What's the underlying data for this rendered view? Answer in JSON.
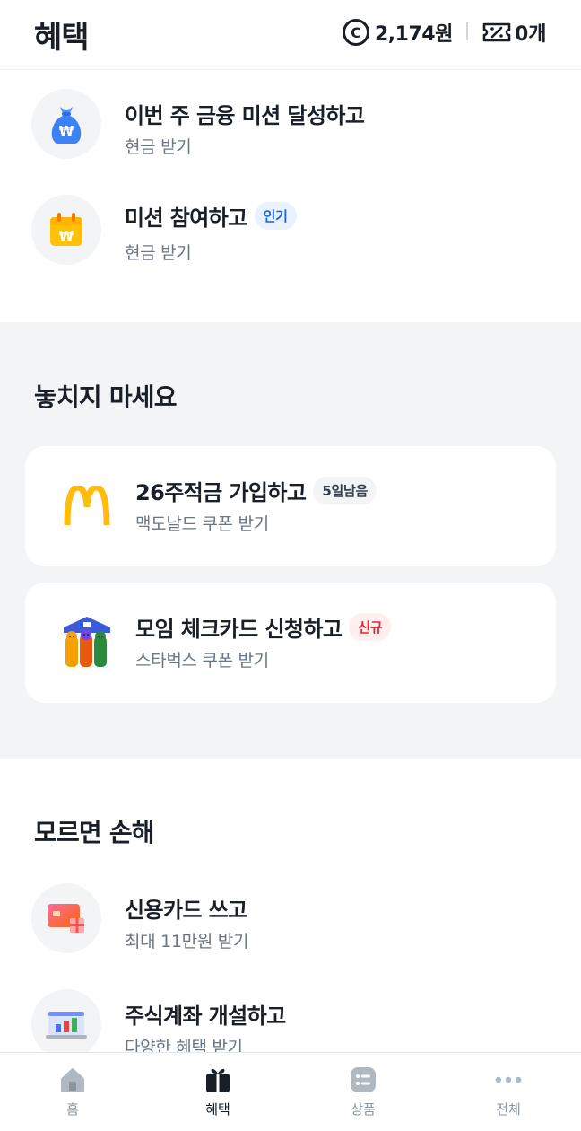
{
  "header": {
    "title": "혜택",
    "points": "2,174원",
    "coupons": "0개"
  },
  "missions": [
    {
      "title": "이번 주 금융 미션 달성하고",
      "subtitle": "현금 받기",
      "icon": "money-bag-icon"
    },
    {
      "title": "미션 참여하고",
      "badge": "인기",
      "subtitle": "현금 받기",
      "icon": "calendar-won-icon"
    }
  ],
  "dont_miss": {
    "title": "놓치지 마세요",
    "cards": [
      {
        "title": "26주적금 가입하고",
        "badge": "5일남음",
        "subtitle": "맥도날드 쿠폰 받기",
        "icon": "mcdonalds-logo"
      },
      {
        "title": "모임 체크카드 신청하고",
        "badge": "신규",
        "subtitle": "스타벅스 쿠폰 받기",
        "icon": "group-house-icon"
      }
    ]
  },
  "dont_lose": {
    "title": "모르면 손해",
    "items": [
      {
        "title": "신용카드 쓰고",
        "subtitle": "최대 11만원 받기",
        "icon": "credit-card-gift-icon"
      },
      {
        "title": "주식계좌 개설하고",
        "subtitle": "다양한 혜택 받기",
        "icon": "stock-chart-icon"
      }
    ]
  },
  "nav": [
    {
      "label": "홈",
      "icon": "home-icon",
      "active": false
    },
    {
      "label": "혜택",
      "icon": "gift-icon",
      "active": true
    },
    {
      "label": "상품",
      "icon": "list-icon",
      "active": false
    },
    {
      "label": "전체",
      "icon": "more-dots-icon",
      "active": false
    }
  ],
  "colors": {
    "accent_blue": "#1b64da",
    "badge_red": "#e42939",
    "section_gray": "#f2f4f6",
    "text_primary": "#191f28",
    "text_secondary": "#6b7684"
  }
}
